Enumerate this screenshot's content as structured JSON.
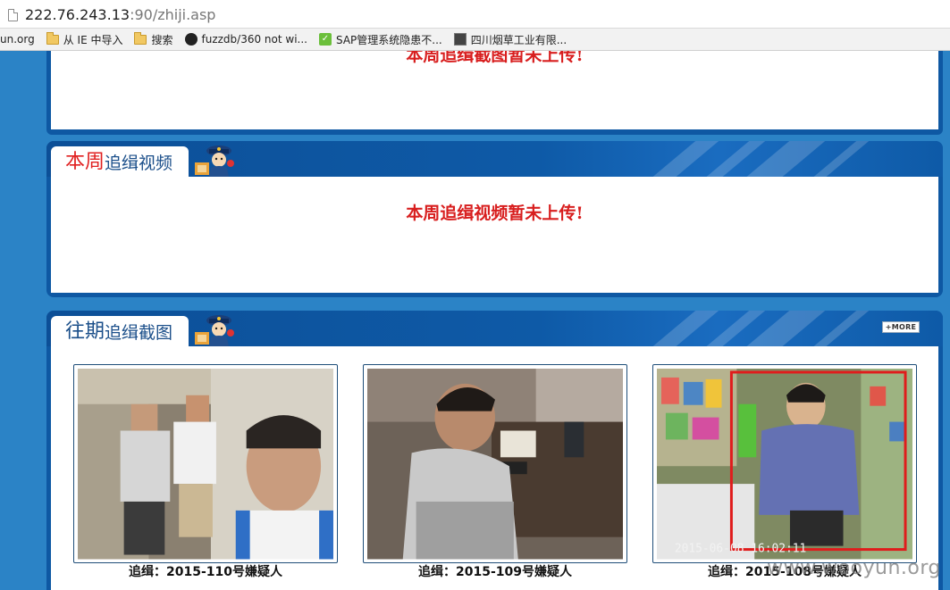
{
  "browser": {
    "url_host": "222.76.243.13",
    "url_path": ":90/zhiji.asp",
    "bookmarks": [
      {
        "label": "un.org",
        "icon": "none"
      },
      {
        "label": "从 IE 中导入",
        "icon": "folder-icon"
      },
      {
        "label": "搜索",
        "icon": "folder-icon"
      },
      {
        "label": "fuzzdb/360 not wi...",
        "icon": "github-icon"
      },
      {
        "label": "SAP管理系统隐患不...",
        "icon": "sap-icon"
      },
      {
        "label": "四川烟草工业有限...",
        "icon": "tobacco-icon"
      }
    ]
  },
  "sections": {
    "screenshot_week": {
      "notice": "本周追缉截图暂未上传!"
    },
    "video_week": {
      "title_accent": "本周",
      "title_rest": "追缉视频",
      "notice": "本周追缉视频暂未上传!"
    },
    "past_screenshots": {
      "title_first": "往期",
      "title_rest": "追缉截图",
      "more_label": "+MORE",
      "items": [
        {
          "caption": "追缉：2015-110号嫌疑人"
        },
        {
          "caption": "追缉：2015-109号嫌疑人"
        },
        {
          "caption": "追缉：2015-108号嫌疑人"
        }
      ]
    }
  },
  "photo3_overlay_text": "2015-06-08  16:02:11",
  "watermark": "www.wooyun.org",
  "colors": {
    "page_background": "#2b83c6",
    "panel_frame": "#0e58a3",
    "notice_red": "#d81e1e",
    "title_blue": "#1b4f8a",
    "title_accent_red": "#e02020"
  }
}
